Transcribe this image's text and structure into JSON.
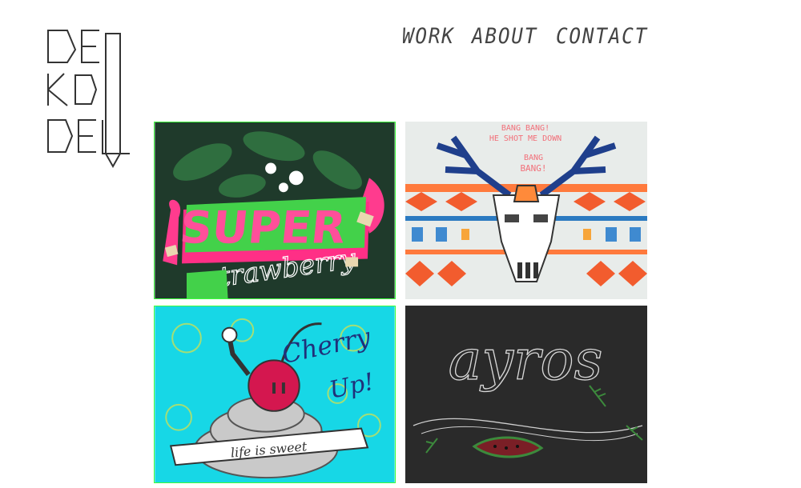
{
  "logo": {
    "line1": "DE",
    "line2": "KO",
    "line3": "DEL"
  },
  "nav": {
    "items": [
      "WORK",
      "ABOUT",
      "CONTACT"
    ]
  },
  "tiles": [
    {
      "id": "super-strawberry",
      "headline": "SUPER",
      "script": "strawberry"
    },
    {
      "id": "deer-skull",
      "line1": "BANG BANG!",
      "line2": "HE SHOT ME DOWN",
      "line3": "BANG",
      "line4": "BANG!"
    },
    {
      "id": "cherry-up",
      "headline": "Cherry",
      "headline2": "Up!",
      "banner": "life is sweet"
    },
    {
      "id": "chalk",
      "script": "ayros"
    }
  ],
  "colors": {
    "accent_border": "#3aff3a",
    "nav_text": "#444444"
  }
}
